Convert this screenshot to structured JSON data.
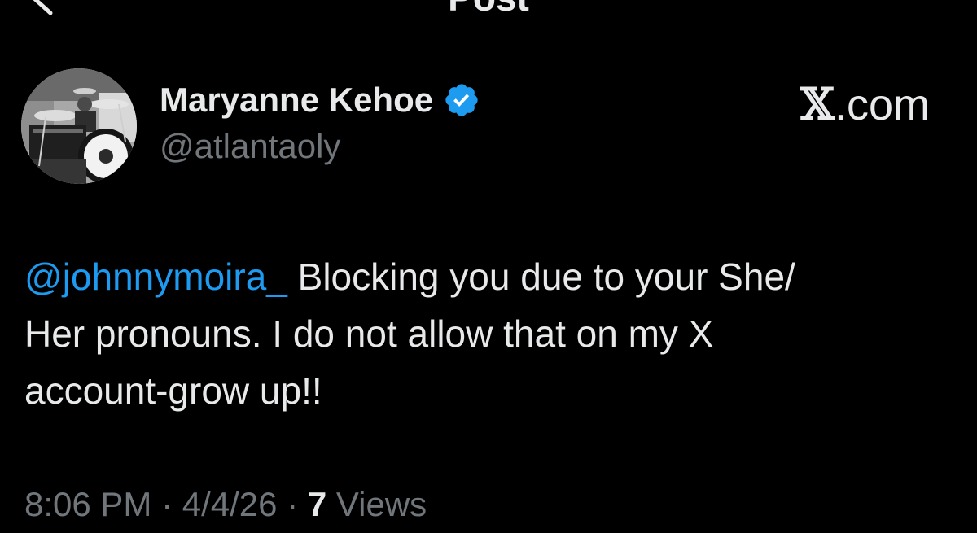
{
  "header": {
    "title": "Post",
    "back_icon": "chevron-left-icon"
  },
  "author": {
    "display_name": "Maryanne Kehoe",
    "handle": "@atlantaoly",
    "verified_icon": "verified-badge-icon",
    "verified_color": "#1d9bf0"
  },
  "brand": {
    "x_glyph": "𝕏",
    "domain": ".com"
  },
  "post": {
    "mention": "@johnnymoira_",
    "text_line1": " Blocking you due to your She/",
    "text_line2": "Her pronouns.  I do not allow that on my X",
    "text_line3": "account-grow up!!"
  },
  "meta": {
    "time": "8:06 PM",
    "separator": " · ",
    "date": "4/4/26",
    "views_count": "7",
    "views_label": " Views"
  },
  "colors": {
    "background": "#000000",
    "text_primary": "#e7e9ea",
    "text_secondary": "#71767b",
    "accent": "#1d9bf0"
  }
}
